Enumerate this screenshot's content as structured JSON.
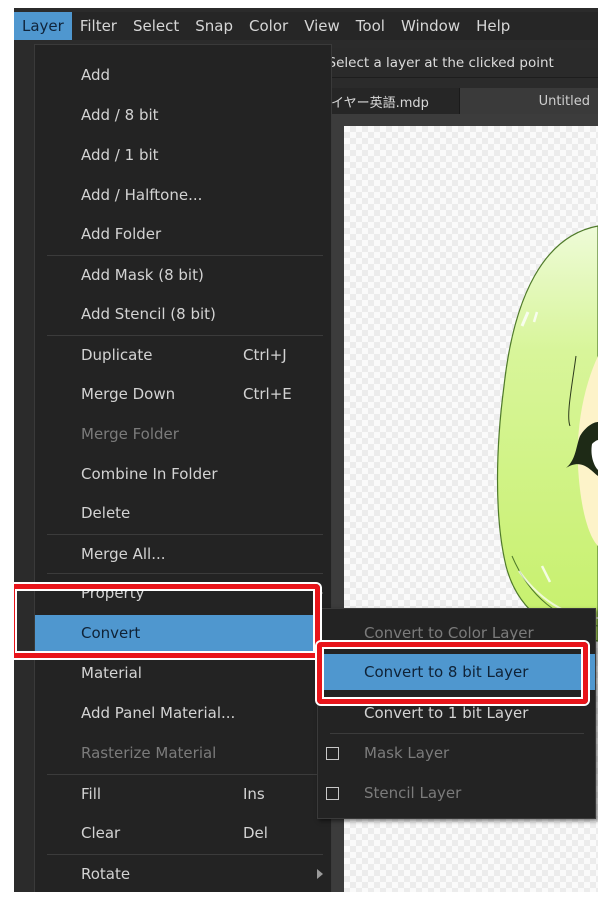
{
  "menubar": {
    "items": [
      "Layer",
      "Filter",
      "Select",
      "Snap",
      "Color",
      "View",
      "Tool",
      "Window",
      "Help"
    ],
    "active": "Layer"
  },
  "tool_options": {
    "text": "] Select a layer at the clicked point"
  },
  "tabs": [
    {
      "label": "レイヤー英語.mdp",
      "active": false
    },
    {
      "label": "Untitled",
      "active": true
    }
  ],
  "layer_menu": {
    "items": [
      {
        "label": "Add"
      },
      {
        "label": "Add / 8 bit"
      },
      {
        "label": "Add / 1 bit"
      },
      {
        "label": "Add / Halftone..."
      },
      {
        "label": "Add Folder"
      },
      {
        "label": "Add Mask (8 bit)"
      },
      {
        "label": "Add Stencil (8 bit)"
      },
      {
        "label": "Duplicate",
        "shortcut": "Ctrl+J"
      },
      {
        "label": "Merge Down",
        "shortcut": "Ctrl+E"
      },
      {
        "label": "Merge Folder",
        "disabled": true
      },
      {
        "label": "Combine In Folder"
      },
      {
        "label": "Delete"
      },
      {
        "label": "Merge All..."
      },
      {
        "label": "Property",
        "submenu": true
      },
      {
        "label": "Convert",
        "submenu": true,
        "highlighted": true
      },
      {
        "label": "Material",
        "submenu": true
      },
      {
        "label": "Add Panel Material..."
      },
      {
        "label": "Rasterize Material",
        "disabled": true
      },
      {
        "label": "Fill",
        "shortcut": "Ins"
      },
      {
        "label": "Clear",
        "shortcut": "Del"
      },
      {
        "label": "Rotate",
        "submenu": true
      }
    ]
  },
  "convert_submenu": {
    "items": [
      {
        "label": "Convert to Color Layer",
        "disabled": true
      },
      {
        "label": "Convert to 8 bit Layer",
        "highlighted": true
      },
      {
        "label": "Convert to 1 bit Layer"
      },
      {
        "label": "Mask Layer",
        "checkbox": true,
        "checked": false,
        "disabled": true
      },
      {
        "label": "Stencil Layer",
        "checkbox": true,
        "checked": false,
        "disabled": true
      }
    ]
  },
  "colors": {
    "highlight": "#4f97cf",
    "callout": "#e8141a",
    "menu_bg": "#232323"
  }
}
